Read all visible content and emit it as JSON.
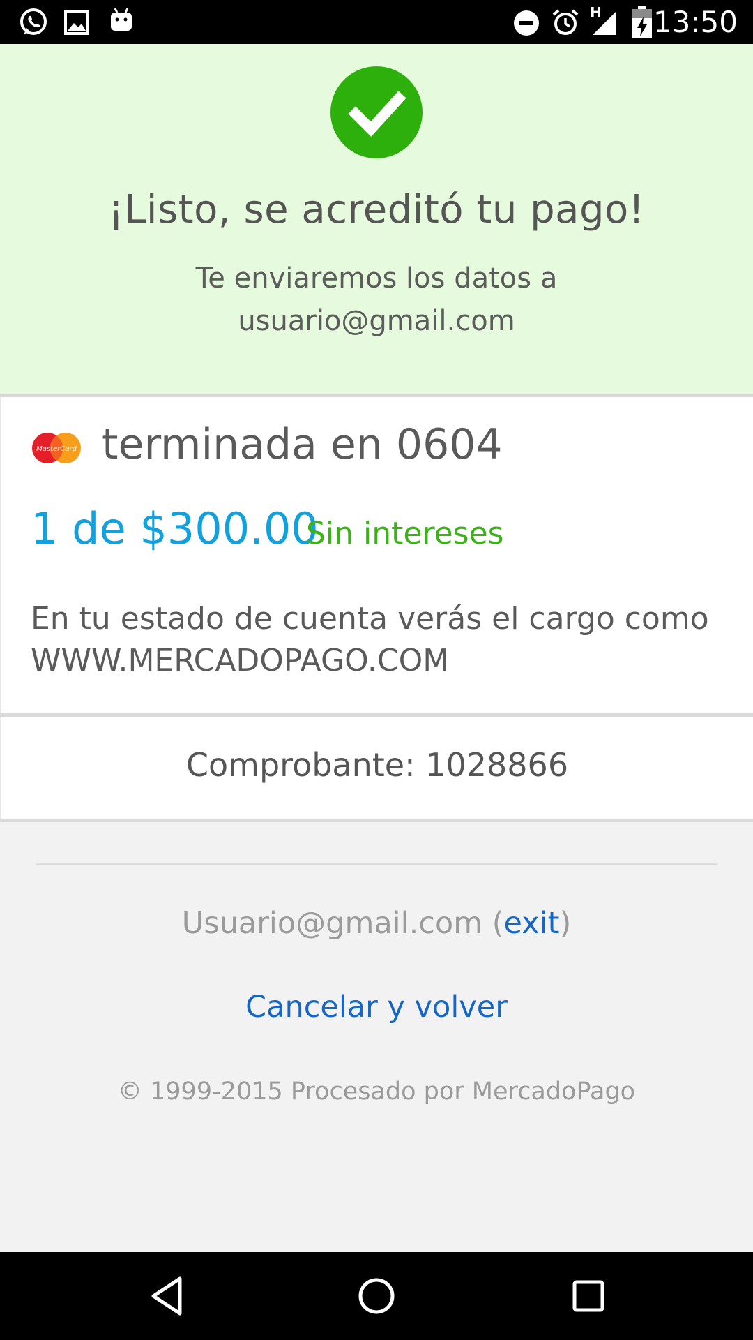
{
  "status_bar": {
    "time": "13:50",
    "left_icons": [
      "whatsapp-icon",
      "image-icon",
      "android-icon"
    ],
    "right_icons": [
      "do-not-disturb-icon",
      "alarm-icon",
      "signal-icon",
      "battery-charging-icon"
    ],
    "network_label": "H"
  },
  "banner": {
    "title": "¡Listo, se acreditó tu pago!",
    "subtitle_line1": "Te enviaremos los datos a",
    "subtitle_line2": "usuario@gmail.com",
    "colors": {
      "background": "#e6fadd",
      "check": "#2eb00c"
    }
  },
  "payment": {
    "card_brand_logo_text": "MasterCard",
    "card_label": "terminada en 0604",
    "installments": "1 de $300.00",
    "interest_note": "Sin intereses",
    "statement_line1": "En tu estado de cuenta verás el cargo como",
    "statement_line2": "WWW.MERCADOPAGO.COM",
    "colors": {
      "installments": "#12a1dc",
      "interest_note": "#3bb318"
    }
  },
  "receipt": {
    "label": "Comprobante: 1028866"
  },
  "footer": {
    "user_email": "Usuario@gmail.com",
    "paren_open": " (",
    "exit_label": "exit",
    "paren_close": ")",
    "cancel_label": "Cancelar y volver",
    "copyright": "© 1999-2015 Procesado por MercadoPago",
    "link_color": "#1666c6"
  },
  "nav_bar": {
    "buttons": [
      "back-icon",
      "home-icon",
      "recents-icon"
    ]
  }
}
